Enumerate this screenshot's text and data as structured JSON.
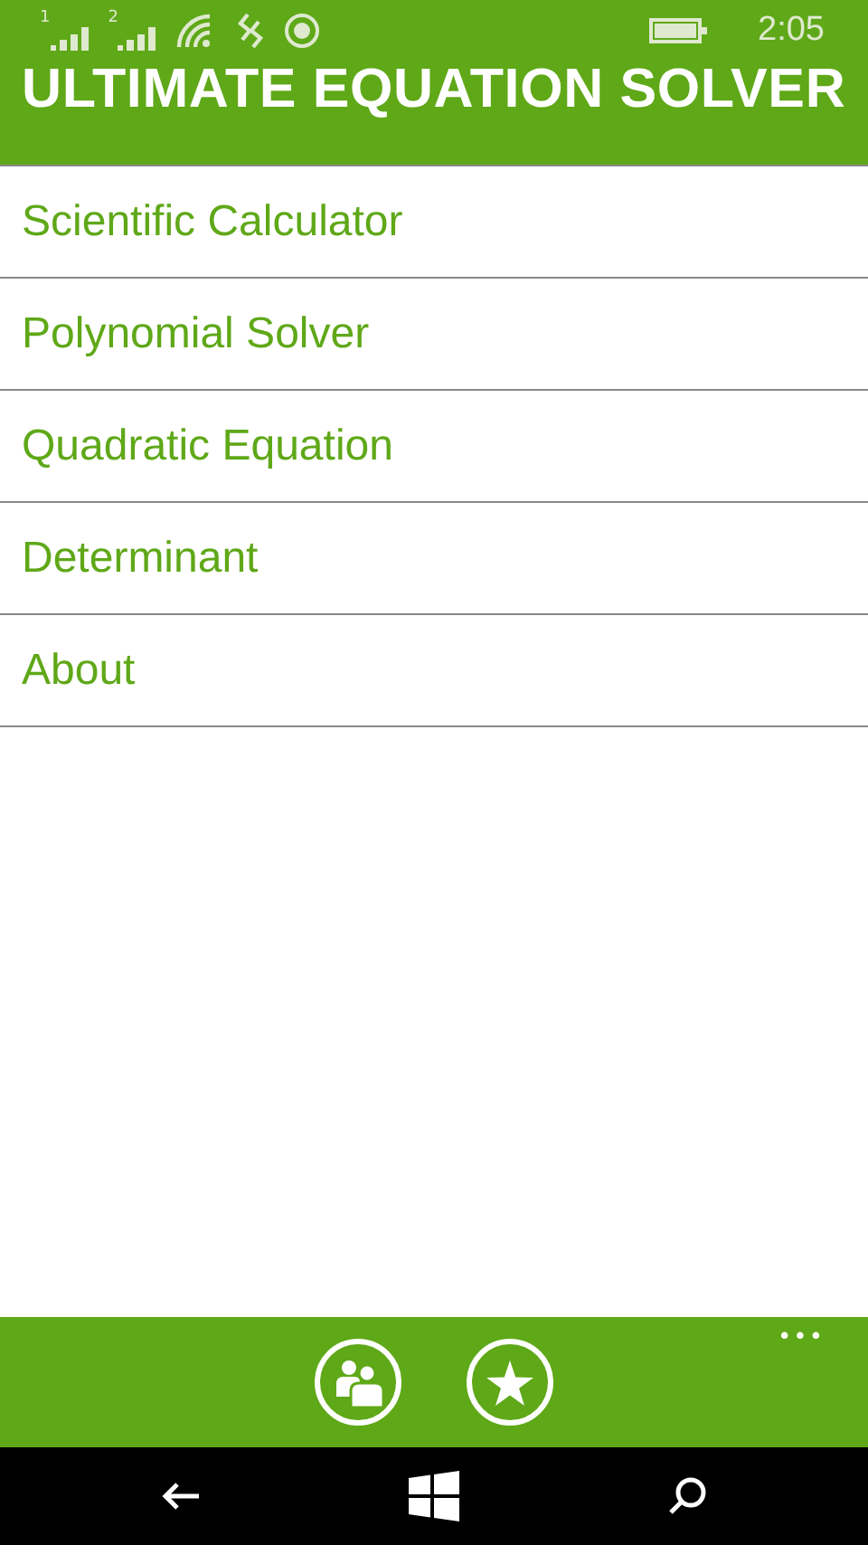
{
  "status_bar": {
    "sim_labels": [
      "1",
      "2"
    ],
    "time": "2:05"
  },
  "title": "ULTIMATE EQUATION SOLVER",
  "menu": [
    {
      "label": "Scientific Calculator"
    },
    {
      "label": "Polynomial Solver"
    },
    {
      "label": "Quadratic Equation"
    },
    {
      "label": "Determinant"
    },
    {
      "label": "About"
    }
  ],
  "app_bar": {
    "more": "•••"
  }
}
